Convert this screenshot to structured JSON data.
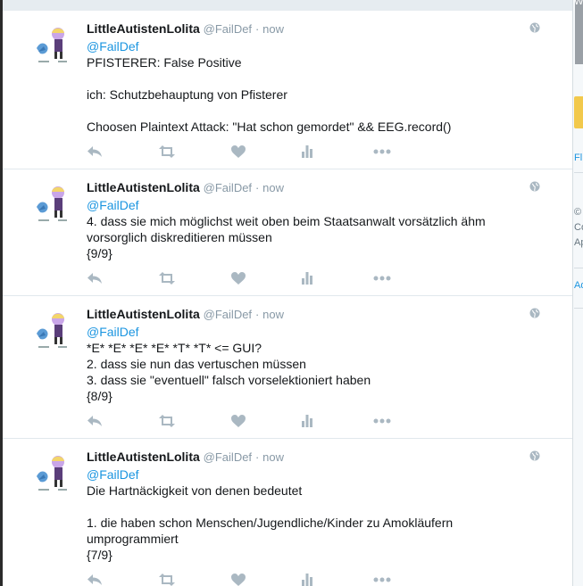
{
  "tweets": [
    {
      "name": "LittleAutistenLolita",
      "handle": "@FailDef",
      "time": "now",
      "mention": "@FailDef",
      "text": "PFISTERER: False Positive\n\nich: Schutzbehauptung von Pfisterer\n\nChoosen Plaintext Attack: \"Hat schon gemordet\" && EEG.record()"
    },
    {
      "name": "LittleAutistenLolita",
      "handle": "@FailDef",
      "time": "now",
      "mention": "@FailDef",
      "text": "4. dass sie mich möglichst weit oben beim Staatsanwalt vorsätzlich ähm vorsorglich diskreditieren müssen\n{9/9}"
    },
    {
      "name": "LittleAutistenLolita",
      "handle": "@FailDef",
      "time": "now",
      "mention": "@FailDef",
      "text": "*E* *E* *E* *E* *T* *T* <= GUI?\n2. dass sie nun das vertuschen müssen\n3. dass sie \"eventuell\" falsch vorselektioniert haben\n{8/9}"
    },
    {
      "name": "LittleAutistenLolita",
      "handle": "@FailDef",
      "time": "now",
      "mention": "@FailDef",
      "text": "Die Hartnäckigkeit von denen bedeutet\n\n1. die haben schon Menschen/Jugendliche/Kinder zu Amokläufern umprogrammiert\n{7/9}"
    }
  ],
  "sidebar_fragments": [
    "W",
    "Fl",
    "©",
    "Co",
    "Ap",
    "Ad"
  ],
  "icons": {
    "reply": "reply-icon",
    "retweet": "retweet-icon",
    "like": "heart-icon",
    "analytics": "analytics-icon",
    "more": "more-icon",
    "globe": "globe-icon"
  }
}
